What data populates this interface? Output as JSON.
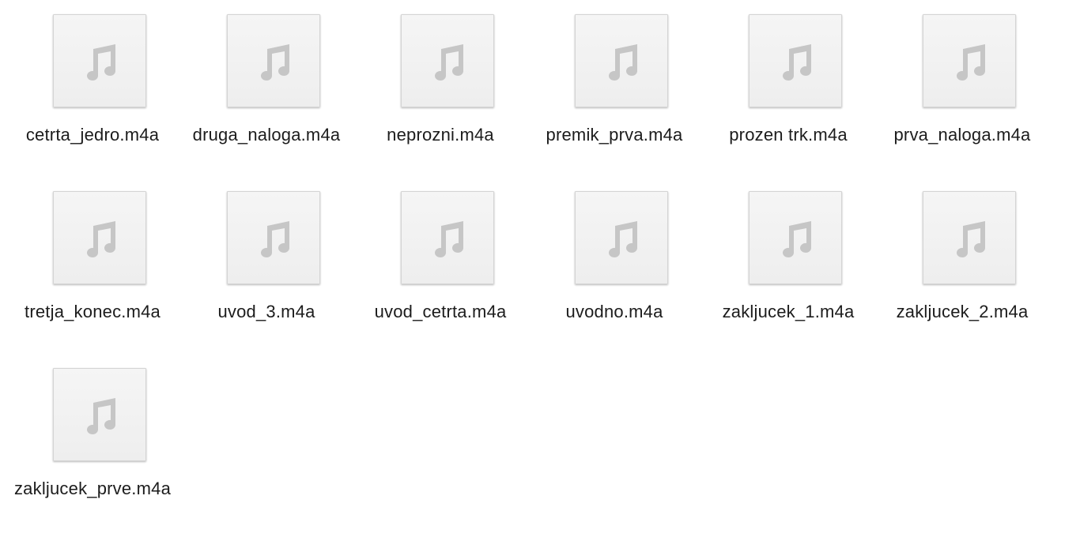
{
  "files": [
    {
      "name": "cetrta_jedro.m4a",
      "icon": "music-note-icon"
    },
    {
      "name": "druga_naloga.m4a",
      "icon": "music-note-icon"
    },
    {
      "name": "neprozni.m4a",
      "icon": "music-note-icon"
    },
    {
      "name": "premik_prva.m4a",
      "icon": "music-note-icon"
    },
    {
      "name": "prozen trk.m4a",
      "icon": "music-note-icon"
    },
    {
      "name": "prva_naloga.m4a",
      "icon": "music-note-icon"
    },
    {
      "name": "tretja_konec.m4a",
      "icon": "music-note-icon"
    },
    {
      "name": "uvod_3.m4a",
      "icon": "music-note-icon"
    },
    {
      "name": "uvod_cetrta.m4a",
      "icon": "music-note-icon"
    },
    {
      "name": "uvodno.m4a",
      "icon": "music-note-icon"
    },
    {
      "name": "zakljucek_1.m4a",
      "icon": "music-note-icon"
    },
    {
      "name": "zakljucek_2.m4a",
      "icon": "music-note-icon"
    },
    {
      "name": "zakljucek_prve.m4a",
      "icon": "music-note-icon"
    }
  ],
  "colors": {
    "icon_gray": "#c6c6c6",
    "thumb_border": "#d4d4d4",
    "label": "#1c1c1c"
  }
}
